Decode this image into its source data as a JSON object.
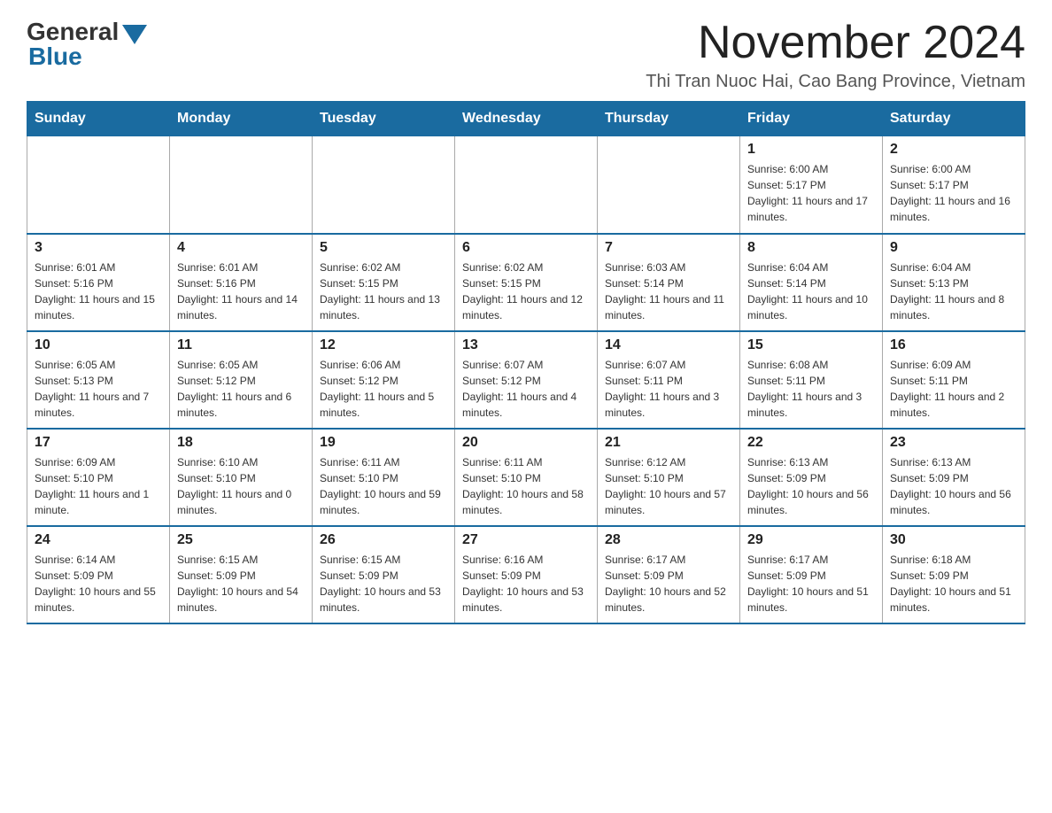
{
  "logo": {
    "general": "General",
    "blue": "Blue"
  },
  "header": {
    "month_title": "November 2024",
    "location": "Thi Tran Nuoc Hai, Cao Bang Province, Vietnam"
  },
  "days_of_week": [
    "Sunday",
    "Monday",
    "Tuesday",
    "Wednesday",
    "Thursday",
    "Friday",
    "Saturday"
  ],
  "weeks": [
    [
      {
        "day": "",
        "info": ""
      },
      {
        "day": "",
        "info": ""
      },
      {
        "day": "",
        "info": ""
      },
      {
        "day": "",
        "info": ""
      },
      {
        "day": "",
        "info": ""
      },
      {
        "day": "1",
        "info": "Sunrise: 6:00 AM\nSunset: 5:17 PM\nDaylight: 11 hours and 17 minutes."
      },
      {
        "day": "2",
        "info": "Sunrise: 6:00 AM\nSunset: 5:17 PM\nDaylight: 11 hours and 16 minutes."
      }
    ],
    [
      {
        "day": "3",
        "info": "Sunrise: 6:01 AM\nSunset: 5:16 PM\nDaylight: 11 hours and 15 minutes."
      },
      {
        "day": "4",
        "info": "Sunrise: 6:01 AM\nSunset: 5:16 PM\nDaylight: 11 hours and 14 minutes."
      },
      {
        "day": "5",
        "info": "Sunrise: 6:02 AM\nSunset: 5:15 PM\nDaylight: 11 hours and 13 minutes."
      },
      {
        "day": "6",
        "info": "Sunrise: 6:02 AM\nSunset: 5:15 PM\nDaylight: 11 hours and 12 minutes."
      },
      {
        "day": "7",
        "info": "Sunrise: 6:03 AM\nSunset: 5:14 PM\nDaylight: 11 hours and 11 minutes."
      },
      {
        "day": "8",
        "info": "Sunrise: 6:04 AM\nSunset: 5:14 PM\nDaylight: 11 hours and 10 minutes."
      },
      {
        "day": "9",
        "info": "Sunrise: 6:04 AM\nSunset: 5:13 PM\nDaylight: 11 hours and 8 minutes."
      }
    ],
    [
      {
        "day": "10",
        "info": "Sunrise: 6:05 AM\nSunset: 5:13 PM\nDaylight: 11 hours and 7 minutes."
      },
      {
        "day": "11",
        "info": "Sunrise: 6:05 AM\nSunset: 5:12 PM\nDaylight: 11 hours and 6 minutes."
      },
      {
        "day": "12",
        "info": "Sunrise: 6:06 AM\nSunset: 5:12 PM\nDaylight: 11 hours and 5 minutes."
      },
      {
        "day": "13",
        "info": "Sunrise: 6:07 AM\nSunset: 5:12 PM\nDaylight: 11 hours and 4 minutes."
      },
      {
        "day": "14",
        "info": "Sunrise: 6:07 AM\nSunset: 5:11 PM\nDaylight: 11 hours and 3 minutes."
      },
      {
        "day": "15",
        "info": "Sunrise: 6:08 AM\nSunset: 5:11 PM\nDaylight: 11 hours and 3 minutes."
      },
      {
        "day": "16",
        "info": "Sunrise: 6:09 AM\nSunset: 5:11 PM\nDaylight: 11 hours and 2 minutes."
      }
    ],
    [
      {
        "day": "17",
        "info": "Sunrise: 6:09 AM\nSunset: 5:10 PM\nDaylight: 11 hours and 1 minute."
      },
      {
        "day": "18",
        "info": "Sunrise: 6:10 AM\nSunset: 5:10 PM\nDaylight: 11 hours and 0 minutes."
      },
      {
        "day": "19",
        "info": "Sunrise: 6:11 AM\nSunset: 5:10 PM\nDaylight: 10 hours and 59 minutes."
      },
      {
        "day": "20",
        "info": "Sunrise: 6:11 AM\nSunset: 5:10 PM\nDaylight: 10 hours and 58 minutes."
      },
      {
        "day": "21",
        "info": "Sunrise: 6:12 AM\nSunset: 5:10 PM\nDaylight: 10 hours and 57 minutes."
      },
      {
        "day": "22",
        "info": "Sunrise: 6:13 AM\nSunset: 5:09 PM\nDaylight: 10 hours and 56 minutes."
      },
      {
        "day": "23",
        "info": "Sunrise: 6:13 AM\nSunset: 5:09 PM\nDaylight: 10 hours and 56 minutes."
      }
    ],
    [
      {
        "day": "24",
        "info": "Sunrise: 6:14 AM\nSunset: 5:09 PM\nDaylight: 10 hours and 55 minutes."
      },
      {
        "day": "25",
        "info": "Sunrise: 6:15 AM\nSunset: 5:09 PM\nDaylight: 10 hours and 54 minutes."
      },
      {
        "day": "26",
        "info": "Sunrise: 6:15 AM\nSunset: 5:09 PM\nDaylight: 10 hours and 53 minutes."
      },
      {
        "day": "27",
        "info": "Sunrise: 6:16 AM\nSunset: 5:09 PM\nDaylight: 10 hours and 53 minutes."
      },
      {
        "day": "28",
        "info": "Sunrise: 6:17 AM\nSunset: 5:09 PM\nDaylight: 10 hours and 52 minutes."
      },
      {
        "day": "29",
        "info": "Sunrise: 6:17 AM\nSunset: 5:09 PM\nDaylight: 10 hours and 51 minutes."
      },
      {
        "day": "30",
        "info": "Sunrise: 6:18 AM\nSunset: 5:09 PM\nDaylight: 10 hours and 51 minutes."
      }
    ]
  ]
}
